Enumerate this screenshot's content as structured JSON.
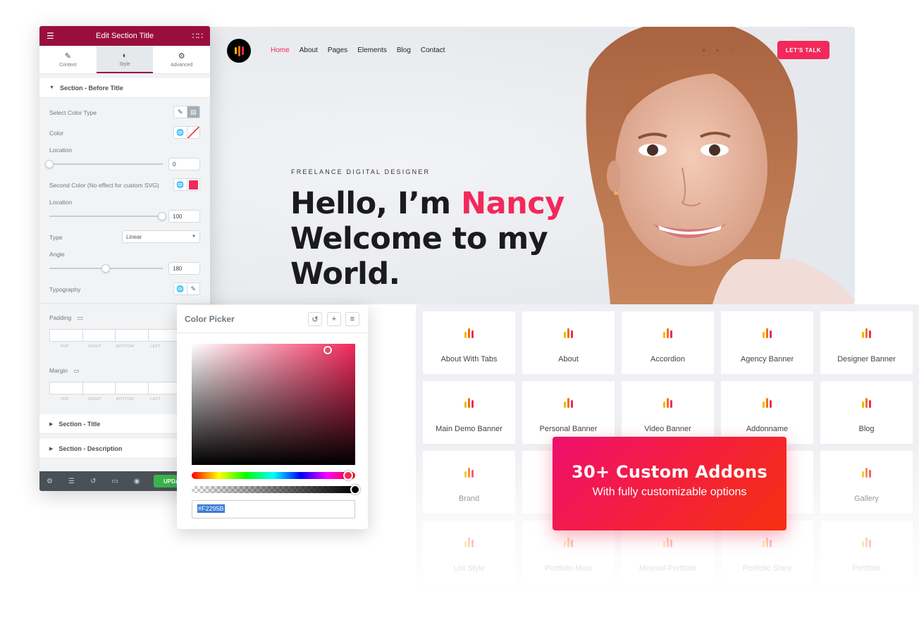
{
  "site": {
    "nav": [
      "Home",
      "About",
      "Pages",
      "Elements",
      "Blog",
      "Contact"
    ],
    "cta": "LET'S TALK",
    "tagline": "FREELANCE DIGITAL DESIGNER",
    "headline_a": "Hello, I’m ",
    "headline_name": "Nancy",
    "headline_b": "Welcome to my",
    "headline_c": "World."
  },
  "panel": {
    "title": "Edit Section Title",
    "tabs": [
      "Content",
      "Style",
      "Advanced"
    ],
    "section_before": "Section - Before Title",
    "color_type_label": "Select Color Type",
    "color_label": "Color",
    "location_label": "Location",
    "location_value": "0",
    "second_color_label": "Second Color (No effect for custom SVG)",
    "location2_label": "Location",
    "location2_value": "100",
    "type_label": "Type",
    "type_value": "Linear",
    "angle_label": "Angle",
    "angle_value": "180",
    "typography_label": "Typography",
    "padding_label": "Padding",
    "margin_label": "Margin",
    "dim_labels": [
      "TOP",
      "RIGHT",
      "BOTTOM",
      "LEFT"
    ],
    "section_title": "Section - Title",
    "section_description": "Section - Description",
    "update_label": "UPDA"
  },
  "picker": {
    "title": "Color Picker",
    "hex": "#F2295B",
    "accent": "#f2295b"
  },
  "addons": {
    "cards": [
      "About With Tabs",
      "About",
      "Accordion",
      "Agency Banner",
      "Designer Banner",
      "Main Demo Banner",
      "Personal Banner",
      "Video Banner",
      "Addonname",
      "Blog",
      "Brand",
      "",
      "",
      "",
      "Gallery",
      "List Style",
      "Portfolio Metx",
      "Minimal Portfolio",
      "Portfolio Stare",
      "Portfolio"
    ],
    "promo_title": "30+ Custom Addons",
    "promo_sub": "With fully customizable options"
  }
}
